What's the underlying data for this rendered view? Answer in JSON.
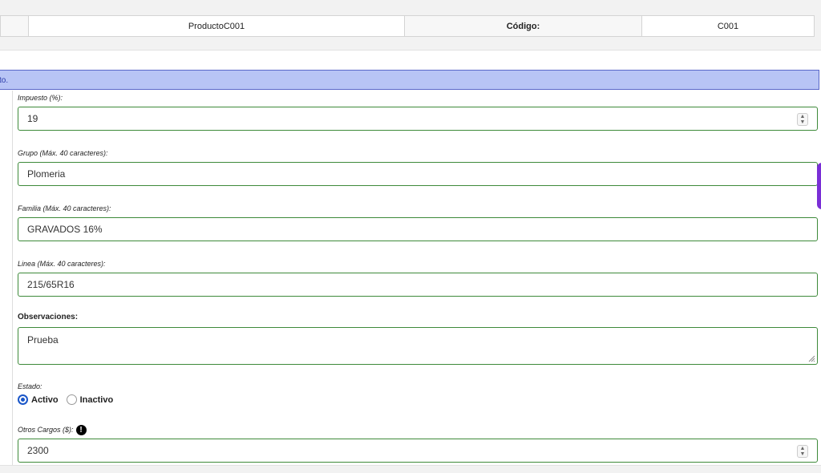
{
  "info": {
    "name_value": "ProductoC001",
    "code_label": "Código:",
    "code_value": "C001"
  },
  "alert": {
    "text": "to."
  },
  "form": {
    "tax": {
      "label": "Impuesto (%):",
      "value": "19"
    },
    "group": {
      "label": "Grupo (Máx. 40 caracteres):",
      "value": "Plomeria"
    },
    "family": {
      "label": "Familia (Máx. 40 caracteres):",
      "value": "GRAVADOS 16%"
    },
    "line": {
      "label": "Linea (Máx. 40 caracteres):",
      "value": "215/65R16"
    },
    "notes": {
      "label": "Observaciones:",
      "value": "Prueba"
    },
    "status": {
      "label": "Estado:",
      "options": [
        "Activo",
        "Inactivo"
      ],
      "selected": "Activo"
    },
    "other_charges": {
      "label": "Otros Cargos ($):",
      "value": "2300"
    }
  },
  "colors": {
    "field_border": "#3e8a3a",
    "alert_bg": "#b8c4f5",
    "radio_selected": "#1a56c8",
    "side_tab": "#7a2fd6"
  },
  "icons": {
    "spinner": "spinner-arrows-icon",
    "warning": "exclamation-icon",
    "resize": "resize-grip-icon"
  }
}
